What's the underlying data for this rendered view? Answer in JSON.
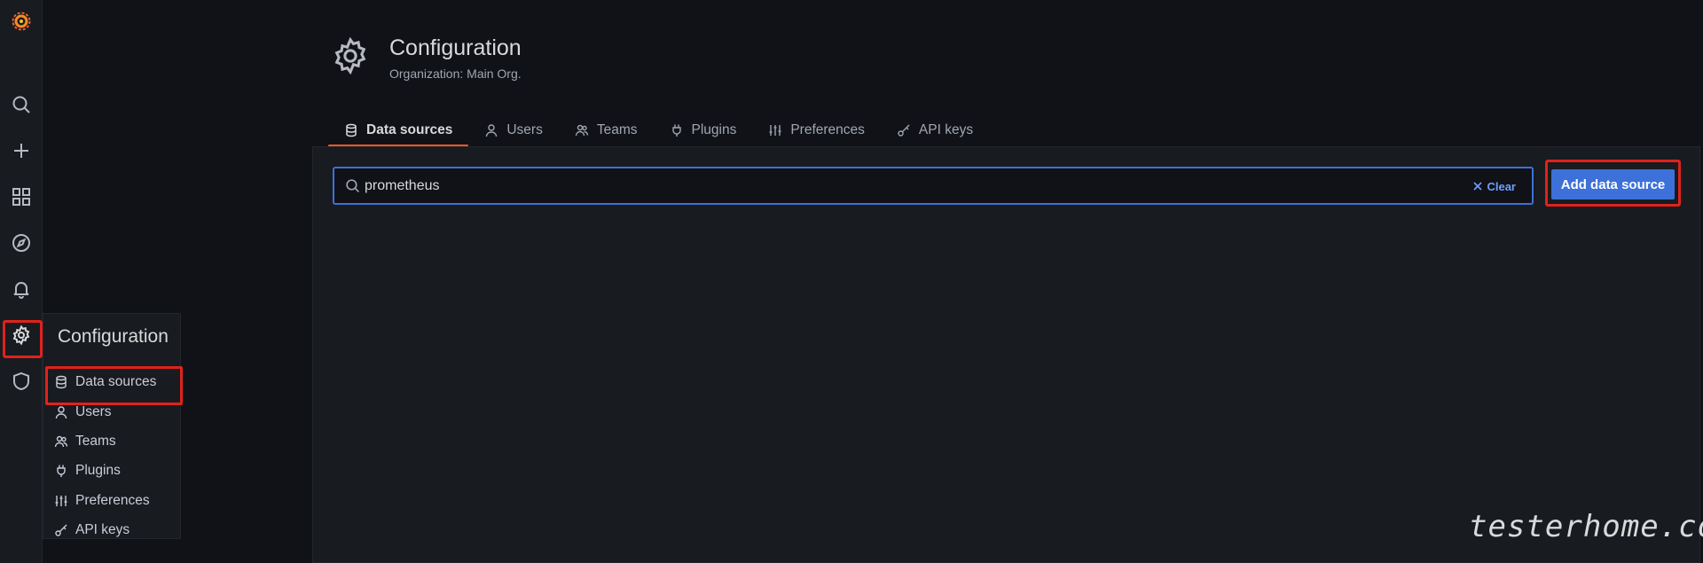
{
  "header": {
    "title": "Configuration",
    "subtitle": "Organization: Main Org."
  },
  "tabs": [
    {
      "label": "Data sources",
      "icon": "database-icon",
      "active": true
    },
    {
      "label": "Users",
      "icon": "user-icon"
    },
    {
      "label": "Teams",
      "icon": "users-icon"
    },
    {
      "label": "Plugins",
      "icon": "plug-icon"
    },
    {
      "label": "Preferences",
      "icon": "sliders-icon"
    },
    {
      "label": "API keys",
      "icon": "key-icon"
    }
  ],
  "search": {
    "value": "prometheus",
    "clear_label": "Clear"
  },
  "actions": {
    "add_label": "Add data source"
  },
  "flyout": {
    "title": "Configuration",
    "items": [
      {
        "label": "Data sources",
        "icon": "database-icon"
      },
      {
        "label": "Users",
        "icon": "user-icon"
      },
      {
        "label": "Teams",
        "icon": "users-icon"
      },
      {
        "label": "Plugins",
        "icon": "plug-icon"
      },
      {
        "label": "Preferences",
        "icon": "sliders-icon"
      },
      {
        "label": "API keys",
        "icon": "key-icon"
      }
    ]
  },
  "rail_icons": [
    "grafana-logo-icon",
    "search-icon",
    "plus-icon",
    "dashboards-icon",
    "compass-icon",
    "bell-icon",
    "gear-icon",
    "shield-icon"
  ],
  "watermark": "testerhome.com",
  "colors": {
    "accent": "#3d71d9",
    "active_tab": "#f05a28",
    "highlight": "#e0221d",
    "link": "#6e9fff"
  }
}
